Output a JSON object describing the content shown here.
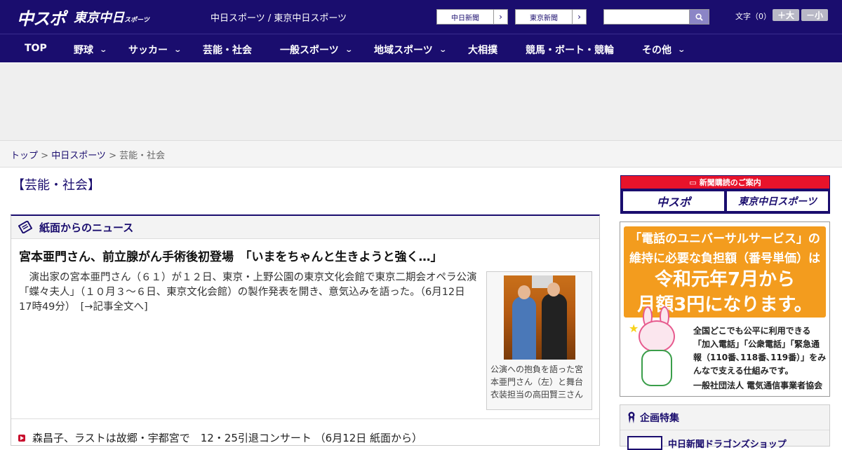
{
  "header": {
    "logo_main": "中スポ",
    "logo_sub": "東京中日",
    "logo_sub_small": "スポーツ",
    "site_title": "中日スポーツ / 東京中日スポーツ",
    "newspaper_buttons": [
      "中日新聞",
      "東京新聞"
    ],
    "search_placeholder": "",
    "font_label": "文字（0）",
    "font_larger": "＋大",
    "font_smaller": "－小"
  },
  "nav": {
    "items": [
      {
        "label": "TOP",
        "has_menu": false
      },
      {
        "label": "野球",
        "has_menu": true
      },
      {
        "label": "サッカー",
        "has_menu": true
      },
      {
        "label": "芸能・社会",
        "has_menu": false
      },
      {
        "label": "一般スポーツ",
        "has_menu": true
      },
      {
        "label": "地域スポーツ",
        "has_menu": true
      },
      {
        "label": "大相撲",
        "has_menu": false
      },
      {
        "label": "競馬・ボート・競輪",
        "has_menu": false
      },
      {
        "label": "その他",
        "has_menu": true
      }
    ]
  },
  "breadcrumb": {
    "home": "トップ",
    "sep": " > ",
    "parent": "中日スポーツ",
    "current": "芸能・社会"
  },
  "section": {
    "title": "【芸能・社会】"
  },
  "news": {
    "box_title": "紙面からのニュース",
    "headline": "宮本亜門さん、前立腺がん手術後初登場　「いまをちゃんと生きようと強く…」",
    "body": "　演出家の宮本亜門さん（６１）が１２日、東京・上野公園の東京文化会館で東京二期会オペラ公演「蝶々夫人」（１０月３～６日、東京文化会館）の製作発表を開き、意気込みを語った。（6月12日 17時49分）　[→記事全文へ]",
    "photo_caption": "公演への抱負を語った宮本亜門さん（左）と舞台衣装担当の高田賢三さん",
    "list": [
      {
        "title": "森昌子、ラストは故郷・宇都宮で　12・25引退コンサート （6月12日 紙面から）"
      }
    ]
  },
  "sidebar": {
    "subscribe_title": "新聞購読のご案内",
    "subscribe_logos": [
      "中スポ",
      "東京中日スポーツ"
    ],
    "banner": {
      "line1": "「電話のユニバーサルサービス」の",
      "line2": "維持に必要な負担額（番号単価）は",
      "line3": "令和元年7月から",
      "line4": "月額3円になります。",
      "body": "全国どこでも公平に利用できる「加入電話」「公衆電話」「緊急通報（110番､118番､119番）」をみんなで支える仕組みです。",
      "org": "一般社団法人 電気通信事業者協会"
    },
    "kikaku_title": "企画特集",
    "kikaku_item": "中日新聞ドラゴンズショップ"
  },
  "colors": {
    "brand_navy": "#1a0d6e",
    "accent_red": "#e8132b",
    "banner_orange": "#f39c1e"
  }
}
